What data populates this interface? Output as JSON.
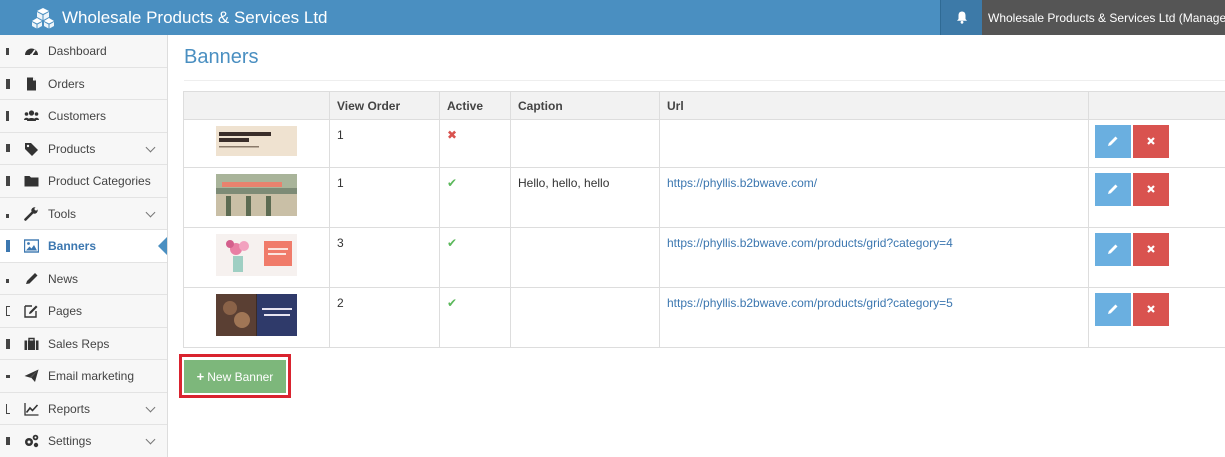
{
  "topbar": {
    "brand": "Wholesale Products & Services Ltd",
    "user": "Wholesale Products & Services Ltd (Manager)",
    "colors": {
      "bar": "#4a8fc1",
      "user_bg": "#555555"
    }
  },
  "sidebar": {
    "items": [
      {
        "label": "Dashboard",
        "icon": "dashboard-icon",
        "expandable": false
      },
      {
        "label": "Orders",
        "icon": "file-icon",
        "expandable": false
      },
      {
        "label": "Customers",
        "icon": "users-icon",
        "expandable": false
      },
      {
        "label": "Products",
        "icon": "tag-icon",
        "expandable": true
      },
      {
        "label": "Product Categories",
        "icon": "folder-icon",
        "expandable": false
      },
      {
        "label": "Tools",
        "icon": "wrench-icon",
        "expandable": true
      },
      {
        "label": "Banners",
        "icon": "image-icon",
        "expandable": false,
        "active": true
      },
      {
        "label": "News",
        "icon": "pencil-icon",
        "expandable": false
      },
      {
        "label": "Pages",
        "icon": "edit-icon",
        "expandable": false
      },
      {
        "label": "Sales Reps",
        "icon": "briefcase-icon",
        "expandable": false
      },
      {
        "label": "Email marketing",
        "icon": "paper-plane-icon",
        "expandable": false
      },
      {
        "label": "Reports",
        "icon": "line-chart-icon",
        "expandable": true
      },
      {
        "label": "Settings",
        "icon": "gears-icon",
        "expandable": true
      }
    ]
  },
  "main": {
    "title": "Banners",
    "table": {
      "headers": [
        "",
        "View Order",
        "Active",
        "Caption",
        "Url",
        ""
      ],
      "rows": [
        {
          "view_order": "1",
          "active": false,
          "caption": "",
          "url": ""
        },
        {
          "view_order": "1",
          "active": true,
          "caption": "Hello, hello, hello",
          "url": "https://phyllis.b2bwave.com/"
        },
        {
          "view_order": "3",
          "active": true,
          "caption": "",
          "url": "https://phyllis.b2bwave.com/products/grid?category=4"
        },
        {
          "view_order": "2",
          "active": true,
          "caption": "",
          "url": "https://phyllis.b2bwave.com/products/grid?category=5"
        }
      ]
    },
    "new_button": "New Banner",
    "colors": {
      "edit": "#6aafe0",
      "delete": "#d9534f",
      "new": "#7db77b",
      "highlight": "#d9232f"
    }
  }
}
